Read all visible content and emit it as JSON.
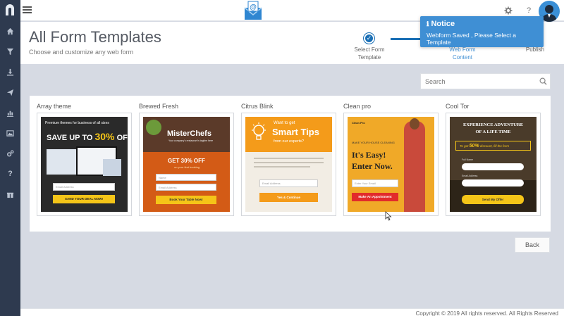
{
  "header": {
    "title": "All Form Templates",
    "subtitle": "Choose and customize any web form"
  },
  "steps": [
    {
      "label": "Select Form Template"
    },
    {
      "label": "Web Form Content"
    },
    {
      "label": "Publish"
    }
  ],
  "notice": {
    "title": "Notice",
    "message": "Webform Saved , Please Select a Template"
  },
  "search": {
    "placeholder": "Search"
  },
  "templates": [
    {
      "name": "Array theme",
      "preview": {
        "tagline": "Premium themes for business of all sizes",
        "headline": "SAVE UP TO",
        "percent": "30%",
        "headline_suffix": "OFF",
        "field": "Email Address",
        "button": "SAND YOUR DEAL NOW!"
      }
    },
    {
      "name": "Brewed Fresh",
      "preview": {
        "brand": "MisterChefs",
        "brand_tagline": "Your company's restaurant's tagline here",
        "offer": "GET 30% OFF",
        "offer_sub": "on your first booking",
        "field_1": "Name",
        "field_2": "Email Address",
        "button": "Book Your Table Now!"
      }
    },
    {
      "name": "Citrus Blink",
      "preview": {
        "kicker": "Want to get",
        "headline": "Smart Tips",
        "sub": "from our experts?",
        "field": "Email Address",
        "button": "Yes & Continue"
      }
    },
    {
      "name": "Clean pro",
      "preview": {
        "brand": "Clean Pro",
        "kicker": "MAKE YOUR HOUSE CLEANING",
        "headline_1": "It's Easy!",
        "headline_2": "Enter Now.",
        "field": "Enter Your Email",
        "button": "Make An Appointment"
      }
    },
    {
      "name": "Cool Tor",
      "preview": {
        "headline_1": "EXPERIENCE ADVENTURE",
        "headline_2": "OF A LIFE TIME",
        "offer_prefix": "To get",
        "offer_percent": "50%",
        "offer_suffix": "discount, fill the form",
        "field_1": "Full Name",
        "field_2": "Email Address",
        "button": "Send My Offer"
      }
    }
  ],
  "back_button": "Back",
  "footer": {
    "copyright": "Copyright © 2019 All rights reserved. All Rights Reserved"
  },
  "colors": {
    "accent": "#3f8fd4",
    "sidebar": "#2e3a4f",
    "step_active": "#1a6fb5"
  }
}
